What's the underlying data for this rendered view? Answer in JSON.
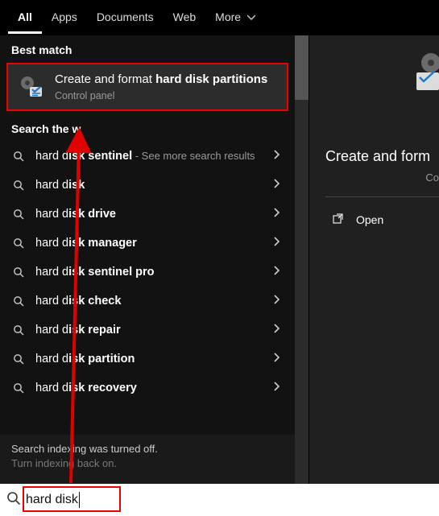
{
  "tabs": {
    "items": [
      {
        "label": "All",
        "active": true
      },
      {
        "label": "Apps",
        "active": false
      },
      {
        "label": "Documents",
        "active": false
      },
      {
        "label": "Web",
        "active": false
      },
      {
        "label": "More",
        "active": false,
        "hasDropdown": true
      }
    ]
  },
  "left": {
    "bestmatch_label": "Best match",
    "bestmatch": {
      "title_prefix": "Create and format ",
      "title_bold": "hard disk partitions",
      "sub": "Control panel"
    },
    "searchweb_label": "Search the web",
    "results": [
      {
        "pre": "hard d",
        "bold": "isk sentinel",
        "post": "",
        "trail": " - See more search results"
      },
      {
        "pre": "hard d",
        "bold": "isk",
        "post": "",
        "trail": ""
      },
      {
        "pre": "hard d",
        "bold": "isk drive",
        "post": "",
        "trail": ""
      },
      {
        "pre": "hard d",
        "bold": "isk manager",
        "post": "",
        "trail": ""
      },
      {
        "pre": "hard d",
        "bold": "isk sentinel pro",
        "post": "",
        "trail": ""
      },
      {
        "pre": "hard d",
        "bold": "isk check",
        "post": "",
        "trail": ""
      },
      {
        "pre": "hard d",
        "bold": "isk repair",
        "post": "",
        "trail": ""
      },
      {
        "pre": "hard d",
        "bold": "isk partition",
        "post": "",
        "trail": ""
      },
      {
        "pre": "hard d",
        "bold": "isk recovery",
        "post": "",
        "trail": ""
      }
    ],
    "indexing": {
      "line1": "Search indexing was turned off.",
      "line2": "Turn indexing back on."
    }
  },
  "right": {
    "title": "Create and form",
    "sub": "Co",
    "open_label": "Open"
  },
  "search": {
    "query": "hard disk"
  },
  "annotation": {
    "color": "#e00000"
  }
}
